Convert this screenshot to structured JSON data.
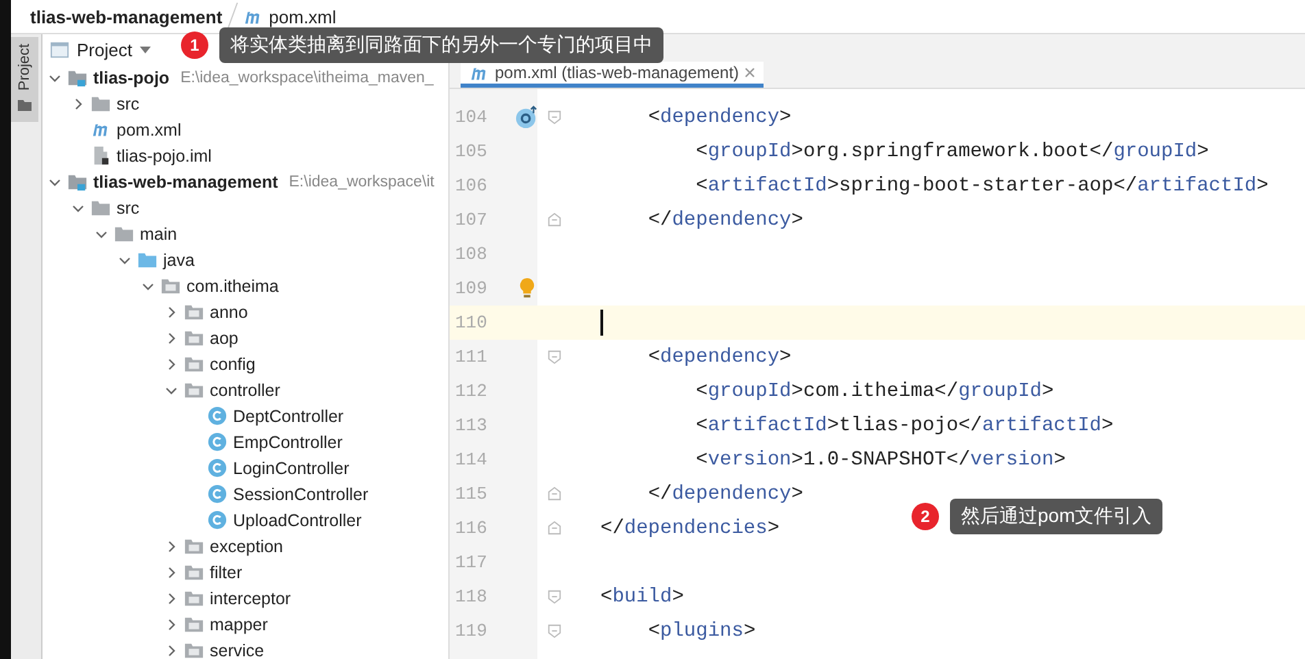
{
  "breadcrumb": [
    {
      "kind": "project",
      "text": "tlias-web-management"
    },
    {
      "kind": "maven",
      "text": "pom.xml"
    }
  ],
  "tool_strip": {
    "label": "Project",
    "selected": true
  },
  "project_panel": {
    "title": "Project",
    "tree": [
      {
        "kind": "module",
        "name": "tlias-pojo",
        "path": "E:\\idea_workspace\\itheima_maven_",
        "expanded": true,
        "children": [
          {
            "kind": "folder",
            "name": "src",
            "expanded": false
          },
          {
            "kind": "maven",
            "name": "pom.xml"
          },
          {
            "kind": "iml",
            "name": "tlias-pojo.iml"
          }
        ]
      },
      {
        "kind": "module",
        "name": "tlias-web-management",
        "path": "E:\\idea_workspace\\it",
        "expanded": true,
        "children": [
          {
            "kind": "folder",
            "name": "src",
            "expanded": true,
            "children": [
              {
                "kind": "folder",
                "name": "main",
                "expanded": true,
                "children": [
                  {
                    "kind": "source",
                    "name": "java",
                    "expanded": true,
                    "children": [
                      {
                        "kind": "package",
                        "name": "com.itheima",
                        "expanded": true,
                        "children": [
                          {
                            "kind": "package",
                            "name": "anno",
                            "expanded": false
                          },
                          {
                            "kind": "package",
                            "name": "aop",
                            "expanded": false
                          },
                          {
                            "kind": "package",
                            "name": "config",
                            "expanded": false
                          },
                          {
                            "kind": "package",
                            "name": "controller",
                            "expanded": true,
                            "children": [
                              {
                                "kind": "class",
                                "name": "DeptController"
                              },
                              {
                                "kind": "class",
                                "name": "EmpController"
                              },
                              {
                                "kind": "class",
                                "name": "LoginController"
                              },
                              {
                                "kind": "class",
                                "name": "SessionController"
                              },
                              {
                                "kind": "class",
                                "name": "UploadController"
                              }
                            ]
                          },
                          {
                            "kind": "package",
                            "name": "exception",
                            "expanded": false
                          },
                          {
                            "kind": "package",
                            "name": "filter",
                            "expanded": false
                          },
                          {
                            "kind": "package",
                            "name": "interceptor",
                            "expanded": false
                          },
                          {
                            "kind": "package",
                            "name": "mapper",
                            "expanded": false
                          },
                          {
                            "kind": "package",
                            "name": "service",
                            "expanded": false
                          }
                        ]
                      }
                    ]
                  }
                ]
              }
            ]
          }
        ]
      }
    ]
  },
  "editor": {
    "tab": {
      "title": "pom.xml (tlias-web-management)",
      "selected": true
    },
    "lines": [
      {
        "number": "104",
        "code": "    <dependency>",
        "gutter": {
          "kind": "override"
        },
        "fold": {
          "kind": "start"
        },
        "current": false
      },
      {
        "number": "105",
        "code": "        <groupId>org.springframework.boot</groupId>",
        "current": false
      },
      {
        "number": "106",
        "code": "        <artifactId>spring-boot-starter-aop</artifactId>",
        "current": false
      },
      {
        "number": "107",
        "code": "    </dependency>",
        "fold": {
          "kind": "end"
        },
        "current": false
      },
      {
        "number": "108",
        "current": false
      },
      {
        "number": "109",
        "gutter": {
          "kind": "bulb"
        },
        "current": false
      },
      {
        "number": "110",
        "current": true
      },
      {
        "number": "111",
        "code": "    <dependency>",
        "fold": {
          "kind": "start"
        },
        "current": false
      },
      {
        "number": "112",
        "code": "        <groupId>com.itheima</groupId>",
        "current": false
      },
      {
        "number": "113",
        "code": "        <artifactId>tlias-pojo</artifactId>",
        "current": false
      },
      {
        "number": "114",
        "code": "        <version>1.0-SNAPSHOT</version>",
        "current": false
      },
      {
        "number": "115",
        "code": "    </dependency>",
        "fold": {
          "kind": "end"
        },
        "current": false
      },
      {
        "number": "116",
        "code": "</dependencies>",
        "fold": {
          "kind": "end"
        },
        "current": false
      },
      {
        "number": "117",
        "current": false
      },
      {
        "number": "118",
        "code": "<build>",
        "fold": {
          "kind": "start"
        },
        "current": false
      },
      {
        "number": "119",
        "code": "    <plugins>",
        "fold": {
          "kind": "start"
        },
        "current": false
      }
    ]
  },
  "callouts": [
    {
      "number": "1",
      "text": "将实体类抽离到同路面下的另外一个专门的项目中"
    },
    {
      "number": "2",
      "text": "然后通过pom文件引入"
    }
  ]
}
